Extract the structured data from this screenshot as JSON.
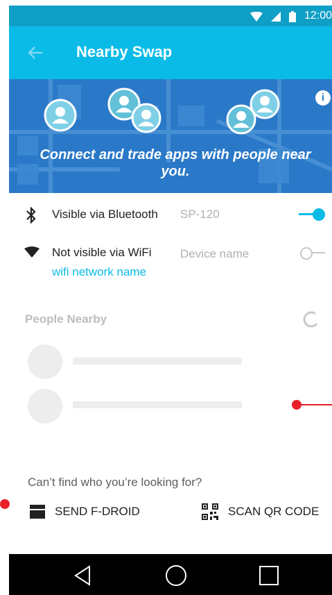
{
  "status_bar": {
    "time": "12:00",
    "icons": [
      "wifi-icon",
      "signal-icon",
      "battery-icon"
    ]
  },
  "app_bar": {
    "title": "Nearby Swap",
    "back_icon": "arrow-left-icon"
  },
  "banner": {
    "text": "Connect and trade apps with people near you.",
    "info_icon": "info-icon"
  },
  "bluetooth": {
    "label": "Visible via Bluetooth",
    "value": "SP-120",
    "enabled": true,
    "icon": "bluetooth-icon"
  },
  "wifi": {
    "label": "Not visible via WiFi",
    "network": "wifi network name",
    "placeholder": "Device name",
    "enabled": false,
    "icon": "wifi-icon"
  },
  "people_nearby": {
    "title": "People Nearby"
  },
  "footer": {
    "help": "Can’t find who you’re looking for?",
    "send_fdroid": "SEND F-DROID",
    "scan_qr": "SCAN QR CODE"
  },
  "colors": {
    "accent": "#0bbbe7",
    "appbar": "#0bbbe7",
    "statusbar": "#0f9fc6",
    "banner": "#2a78c8",
    "marker": "#e8202a"
  }
}
